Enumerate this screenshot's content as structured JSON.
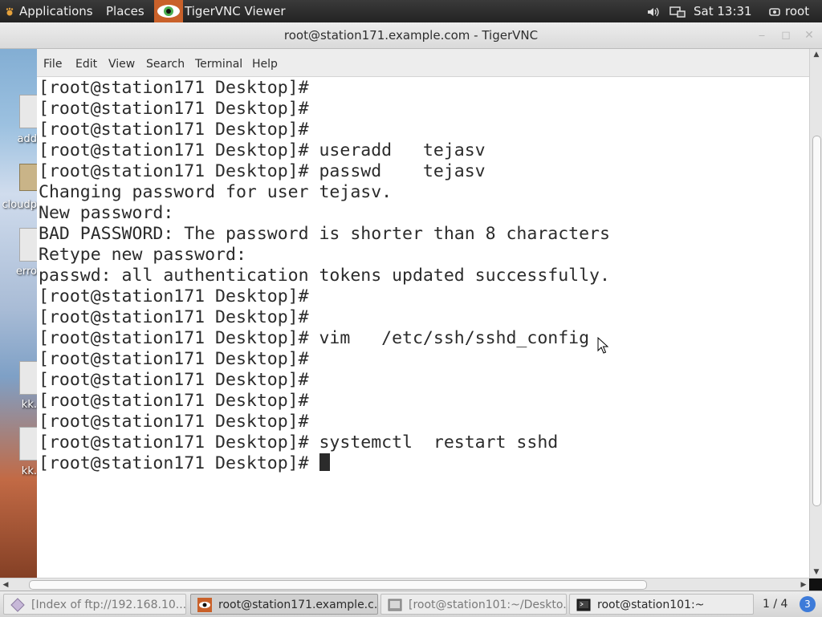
{
  "top_panel": {
    "applications_label": "Applications",
    "places_label": "Places",
    "app_label": "TigerVNC Viewer",
    "clock": "Sat 13:31",
    "user": "root",
    "icons": [
      "volume-icon",
      "network-icon",
      "user-icon"
    ]
  },
  "desktop": {
    "labels": [
      "add",
      "cloudp",
      "erro",
      "kk.",
      "kk."
    ]
  },
  "vnc_window": {
    "title": "root@station171.example.com - TigerVNC",
    "buttons": [
      "minimize",
      "maximize",
      "close"
    ]
  },
  "terminal": {
    "menu": [
      "File",
      "Edit",
      "View",
      "Search",
      "Terminal",
      "Help"
    ],
    "lines": [
      "[root@station171 Desktop]#",
      "[root@station171 Desktop]#",
      "[root@station171 Desktop]#",
      "[root@station171 Desktop]# useradd   tejasv",
      "[root@station171 Desktop]# passwd    tejasv",
      "Changing password for user tejasv.",
      "New password:",
      "BAD PASSWORD: The password is shorter than 8 characters",
      "Retype new password:",
      "passwd: all authentication tokens updated successfully.",
      "[root@station171 Desktop]#",
      "[root@station171 Desktop]#",
      "[root@station171 Desktop]# vim   /etc/ssh/sshd_config",
      "[root@station171 Desktop]#",
      "[root@station171 Desktop]#",
      "[root@station171 Desktop]#",
      "[root@station171 Desktop]#",
      "[root@station171 Desktop]# systemctl  restart sshd"
    ],
    "prompt": "[root@station171 Desktop]# "
  },
  "taskbar": {
    "tasks": [
      "[Index of ftp://192.168.10....",
      "root@station171.example.c...",
      "[root@station101:~/Deskto...",
      "root@station101:~"
    ],
    "workspace": "1 / 4",
    "workspace_badge": "3"
  },
  "colors": {
    "accent": "#3d7bd9",
    "terminal_bg": "#ffffff",
    "terminal_fg": "#2b2b2b",
    "panel_bg": "#2b2b2b"
  }
}
